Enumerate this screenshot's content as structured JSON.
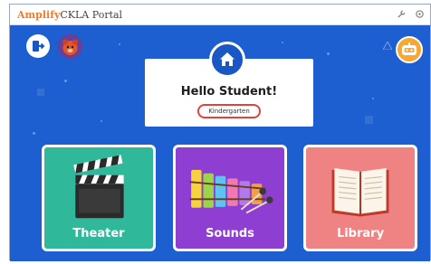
{
  "window": {
    "brand_amplify": "Amplify",
    "brand_rest": "CKLA Portal"
  },
  "header": {
    "greeting": "Hello Student!",
    "grade": "Kindergarten"
  },
  "tiles": [
    {
      "label": "Theater",
      "color": "#2fb89a"
    },
    {
      "label": "Sounds",
      "color": "#8e3ed0"
    },
    {
      "label": "Library",
      "color": "#ef8383"
    }
  ],
  "colors": {
    "background": "#1d5fd0",
    "accent_orange": "#f7a733",
    "grade_border": "#e0433b"
  },
  "icons": {
    "titlebar": [
      "wrench-icon",
      "settings-icon"
    ],
    "top_left": [
      "exit-icon",
      "avatar-icon"
    ],
    "top_right": "robot-icon",
    "center": "home-icon"
  }
}
